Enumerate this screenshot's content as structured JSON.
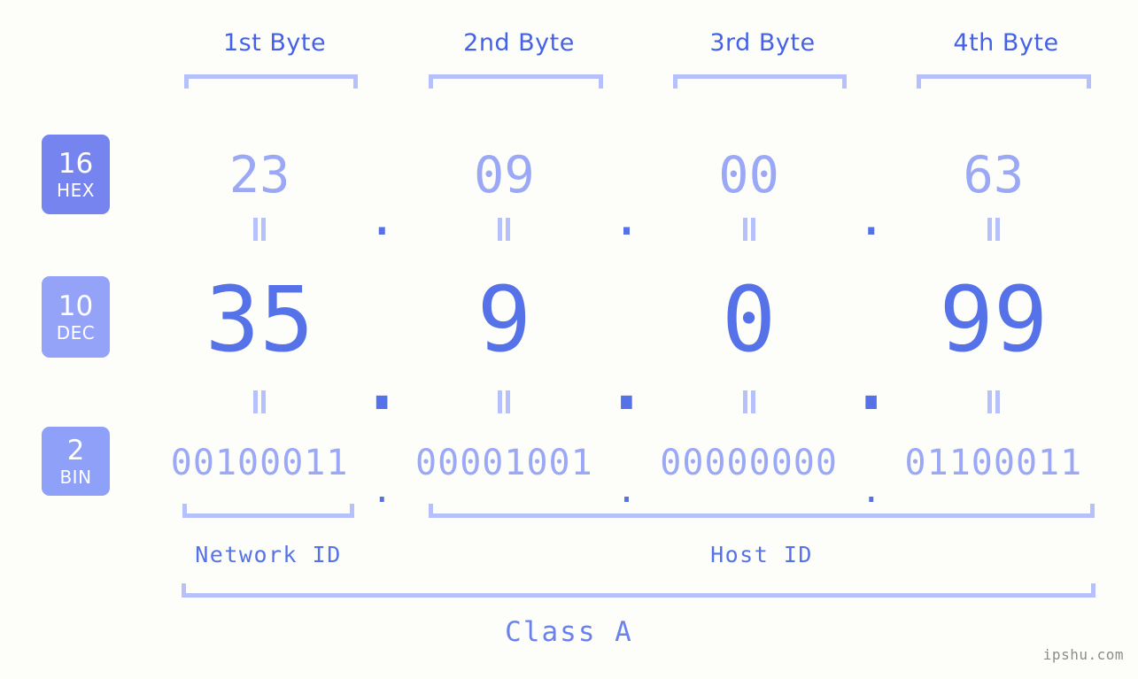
{
  "meta": {
    "background_color": "#fdfefa",
    "accent_strong": "#5672e8",
    "accent_light": "#9aa8f6",
    "bracket_color": "#b6c0fb",
    "watermark_color": "#8c8c8c"
  },
  "byte_headers": [
    {
      "label": "1st Byte"
    },
    {
      "label": "2nd Byte"
    },
    {
      "label": "3rd Byte"
    },
    {
      "label": "4th Byte"
    }
  ],
  "radix_badges": [
    {
      "number": "16",
      "abbr": "HEX",
      "color": "#7584ef"
    },
    {
      "number": "10",
      "abbr": "DEC",
      "color": "#94a3f7"
    },
    {
      "number": "2",
      "abbr": "BIN",
      "color": "#8fa0f8"
    }
  ],
  "rows": {
    "hex": {
      "radix": "16",
      "values": [
        "23",
        "09",
        "00",
        "63"
      ],
      "separator": "."
    },
    "dec": {
      "radix": "10",
      "values": [
        "35",
        "9",
        "0",
        "99"
      ],
      "separator": "."
    },
    "bin": {
      "radix": "2",
      "values": [
        "00100011",
        "00001001",
        "00000000",
        "01100011"
      ],
      "separator": "."
    }
  },
  "equality_marks": {
    "glyph": "||",
    "count_per_row": 4
  },
  "id_sections": [
    {
      "label": "Network ID"
    },
    {
      "label": "Host ID"
    }
  ],
  "class_label": "Class A",
  "watermark": "ipshu.com"
}
